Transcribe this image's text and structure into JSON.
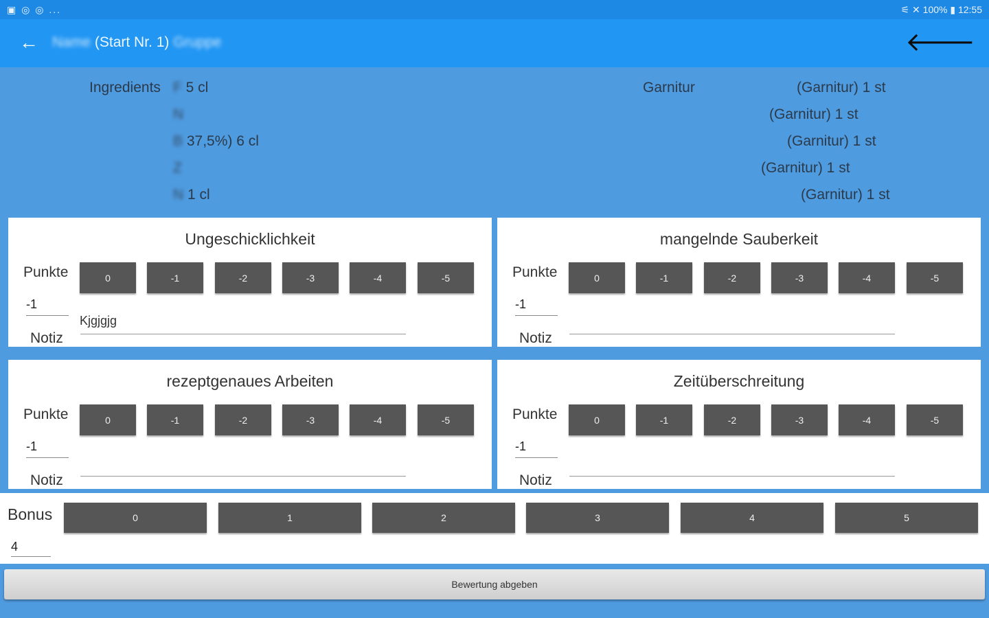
{
  "status_bar": {
    "left_icons": "▣ ◎ ◎ ...",
    "right": "⚟ ✕ 100% ▮ 12:55"
  },
  "appbar": {
    "back_icon": "←",
    "title_prefix_blurred": "Name",
    "title_start": "(Start Nr. 1)",
    "title_suffix_blurred": "Gruppe",
    "forward_icon": "🡐"
  },
  "ingredients": {
    "label": "Ingredients",
    "lines": [
      {
        "blurred": "F",
        "visible": "5 cl"
      },
      {
        "blurred": "N",
        "visible": ""
      },
      {
        "blurred": "B",
        "visible": "37,5%) 6 cl"
      },
      {
        "blurred": "Z",
        "visible": ""
      },
      {
        "blurred": "N",
        "visible": "1 cl"
      }
    ]
  },
  "garnitur": {
    "label": "Garnitur",
    "lines": [
      {
        "visible": "(Garnitur) 1 st"
      },
      {
        "visible": "(Garnitur) 1 st"
      },
      {
        "visible": "(Garnitur) 1 st"
      },
      {
        "visible": "(Garnitur) 1 st"
      },
      {
        "visible": "(Garnitur) 1 st"
      }
    ]
  },
  "score_buttons": [
    "0",
    "-1",
    "-2",
    "-3",
    "-4",
    "-5"
  ],
  "punkte_label": "Punkte",
  "notiz_label": "Notiz",
  "cards": [
    {
      "title": "Ungeschicklichkeit",
      "value": "-1",
      "notiz": "Kjgjgjg"
    },
    {
      "title": "mangelnde Sauberkeit",
      "value": "-1",
      "notiz": ""
    },
    {
      "title": "rezeptgenaues Arbeiten",
      "value": "-1",
      "notiz": ""
    },
    {
      "title": "Zeitüberschreitung",
      "value": "-1",
      "notiz": ""
    }
  ],
  "bonus": {
    "label": "Bonus",
    "buttons": [
      "0",
      "1",
      "2",
      "3",
      "4",
      "5"
    ],
    "value": "4"
  },
  "submit_label": "Bewertung abgeben"
}
